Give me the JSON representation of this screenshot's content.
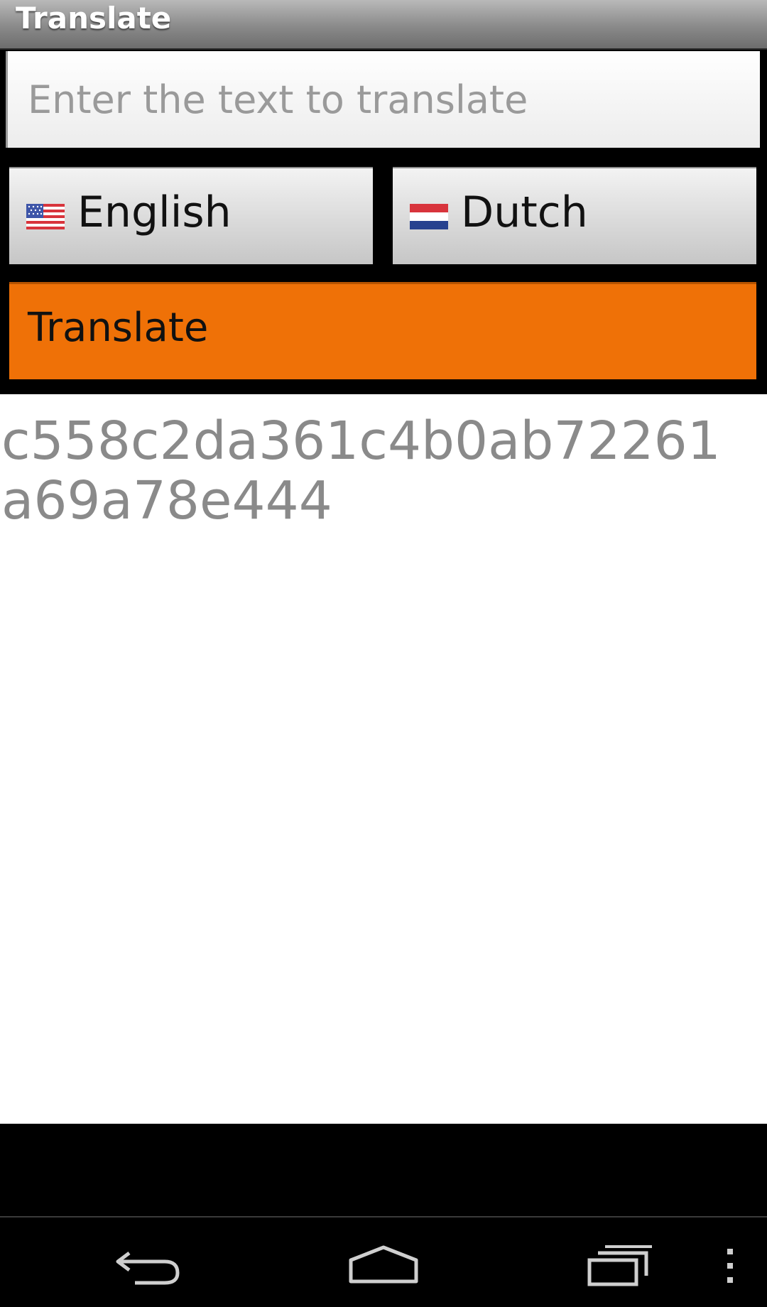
{
  "app": {
    "title": "Translate"
  },
  "input": {
    "placeholder": "Enter the text to translate",
    "value": ""
  },
  "languages": {
    "source": {
      "label": "English",
      "flag_icon": "us-flag-icon"
    },
    "target": {
      "label": "Dutch",
      "flag_icon": "netherlands-flag-icon"
    }
  },
  "actions": {
    "translate_label": "Translate"
  },
  "result": {
    "text": "c558c2da361c4b0ab72261a69a78e444"
  },
  "colors": {
    "accent": "#ef7107",
    "result_text": "#8a8a8a"
  },
  "navbar": {
    "icons": [
      "back-icon",
      "home-icon",
      "recent-apps-icon",
      "overflow-menu-icon"
    ]
  }
}
